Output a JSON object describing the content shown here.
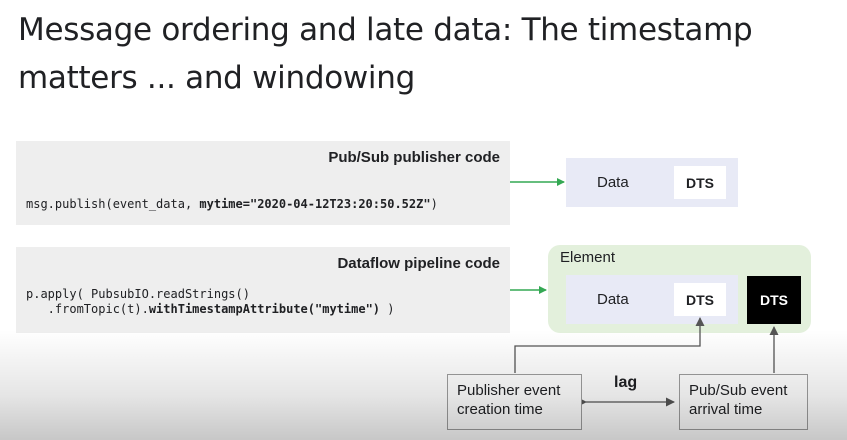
{
  "slide": {
    "title_line1": "Message ordering and late data: The timestamp",
    "title_line2": "matters ... and windowing"
  },
  "publisher": {
    "header": "Pub/Sub publisher code",
    "code_prefix": "msg.publish(event_data, ",
    "code_bold": "mytime=\"2020-04-12T23:20:50.52Z\"",
    "code_suffix": ")"
  },
  "pipeline": {
    "header": "Dataflow pipeline code",
    "line1": "p.apply( PubsubIO.readStrings()",
    "line2_prefix": "   .fromTopic(t).",
    "line2_bold": "withTimestampAttribute(\"mytime\")",
    "line2_suffix": " )"
  },
  "message_box": {
    "data_label": "Data",
    "dts_label": "DTS"
  },
  "element_box": {
    "label": "Element",
    "data_label": "Data",
    "dts_label": "DTS",
    "dts_black_label": "DTS"
  },
  "timeline": {
    "publisher_time_line1": "Publisher event",
    "publisher_time_line2": "creation time",
    "lag_label": "lag",
    "arrival_time_line1": "Pub/Sub event",
    "arrival_time_line2": "arrival time"
  },
  "colors": {
    "arrow_green": "#34a853",
    "element_bg": "#e3f0dc",
    "databox_bg": "#e8eaf6",
    "code_bg": "#eeeeee"
  }
}
